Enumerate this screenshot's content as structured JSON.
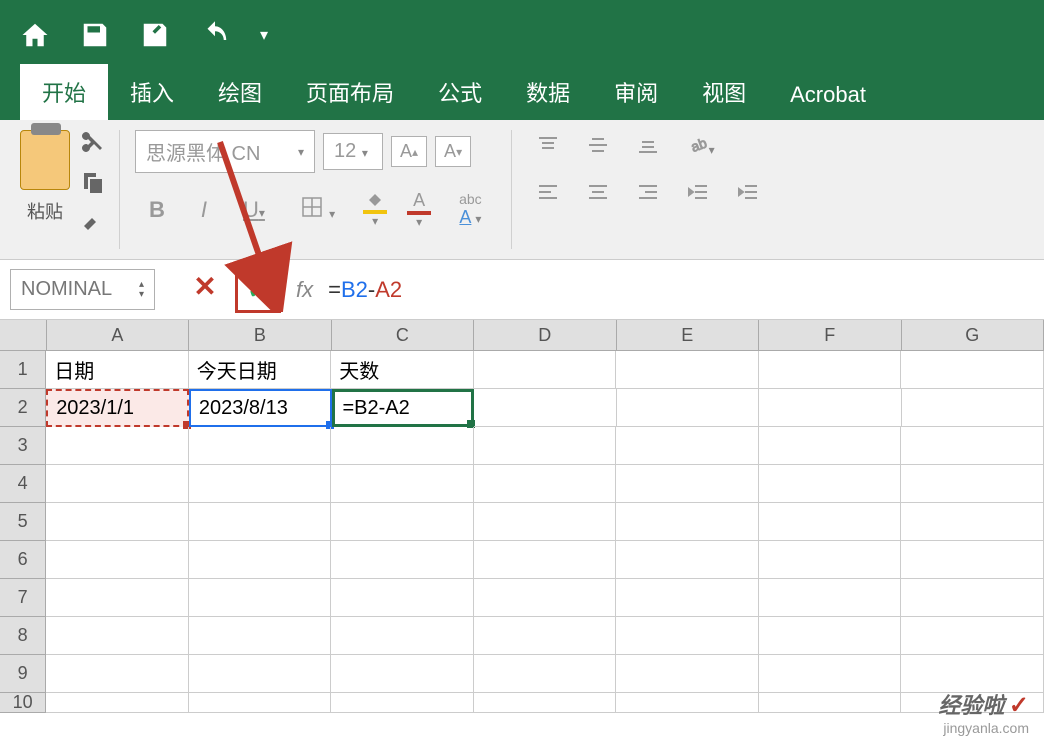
{
  "titlebar": {
    "home_icon": "home",
    "save_icon": "save",
    "edit_icon": "edit",
    "undo_icon": "undo"
  },
  "tabs": {
    "start": "开始",
    "insert": "插入",
    "draw": "绘图",
    "layout": "页面布局",
    "formula": "公式",
    "data": "数据",
    "review": "审阅",
    "view": "视图",
    "acrobat": "Acrobat"
  },
  "ribbon": {
    "paste_label": "粘贴",
    "font_name": "思源黑体 CN",
    "font_size": "12",
    "increase_font": "A",
    "decrease_font": "A",
    "bold": "B",
    "italic": "I",
    "underline": "U",
    "pinyin": "abc",
    "letter_a": "A"
  },
  "formula_bar": {
    "name_box": "NOMINAL",
    "fx": "fx",
    "equals": "=",
    "ref1": "B2",
    "minus": "-",
    "ref2": "A2"
  },
  "columns": [
    "A",
    "B",
    "C",
    "D",
    "E",
    "F",
    "G"
  ],
  "rows": [
    "1",
    "2",
    "3",
    "4",
    "5",
    "6",
    "7",
    "8",
    "9",
    "10"
  ],
  "cells": {
    "a1": "日期",
    "b1": "今天日期",
    "c1": "天数",
    "a2": "2023/1/1",
    "b2": "2023/8/13",
    "c2": "=B2-A2"
  },
  "watermark": {
    "brand": "经验啦",
    "url": "jingyanla.com"
  }
}
